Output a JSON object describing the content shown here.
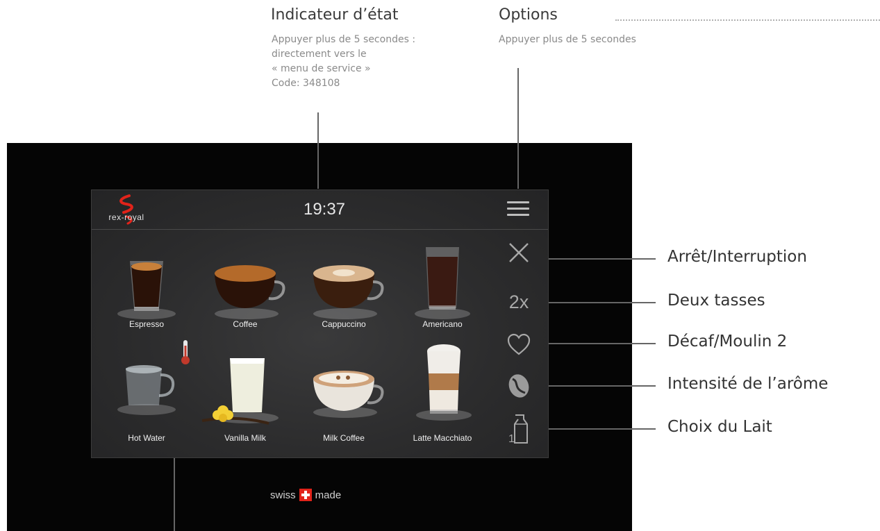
{
  "annotations": {
    "status_indicator": {
      "title": "Indicateur d’état",
      "lines": [
        "Appuyer plus de 5 secondes :",
        "directement vers le",
        "« menu de service »",
        "Code: 348108"
      ]
    },
    "options": {
      "title": "Options",
      "note": "Appuyer plus de 5 secondes"
    }
  },
  "callouts": {
    "stop": "Arrêt/Interruption",
    "two_cups": "Deux tasses",
    "decaf": "Décaf/Moulin 2",
    "aroma": "Intensité de l’arôme",
    "milk": "Choix du Lait"
  },
  "screen": {
    "brand": "rex-royal",
    "time": "19:37",
    "two_cups_label": "2x",
    "drinks": [
      {
        "name": "Espresso",
        "icon": "espresso-glass-icon"
      },
      {
        "name": "Coffee",
        "icon": "coffee-cup-icon"
      },
      {
        "name": "Cappuccino",
        "icon": "cappuccino-cup-icon"
      },
      {
        "name": "Americano",
        "icon": "americano-glass-icon"
      },
      {
        "name": "Hot Water",
        "icon": "hot-water-mug-icon"
      },
      {
        "name": "Vanilla Milk",
        "icon": "vanilla-milk-glass-icon"
      },
      {
        "name": "Milk Coffee",
        "icon": "milk-coffee-cup-icon"
      },
      {
        "name": "Latte Macchiato",
        "icon": "latte-macchiato-glass-icon"
      }
    ]
  },
  "footer": {
    "swiss_left": "swiss",
    "swiss_right": "made"
  },
  "colors": {
    "bezel": "#050505",
    "screen": "#2c2c2d",
    "swiss_red": "#e2231a",
    "thermometer_red": "#c0392b"
  }
}
